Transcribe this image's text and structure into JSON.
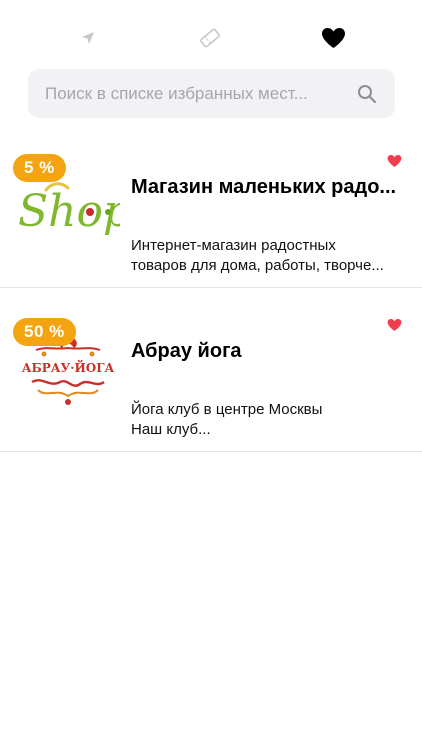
{
  "tabs": [
    {
      "name": "nearby",
      "icon": "location-arrow-icon",
      "active": false
    },
    {
      "name": "coupons",
      "icon": "ticket-icon",
      "active": false
    },
    {
      "name": "favorites",
      "icon": "heart-icon",
      "active": true
    }
  ],
  "search": {
    "placeholder": "Поиск в списке избранных мест...",
    "value": ""
  },
  "items": [
    {
      "badge": "5 %",
      "title": "Магазин маленьких радо...",
      "description_lines": [
        "Интернет-магазин радостных",
        "товаров для дома, работы, творче..."
      ],
      "logo_text": "Shop",
      "favorite": true
    },
    {
      "badge": "50 %",
      "title": "Абрау йога",
      "description_lines": [
        "Йога клуб в центре Москвы",
        "Наш клуб..."
      ],
      "logo_text": "АБРАУ·ЙОГА",
      "favorite": true
    }
  ],
  "colors": {
    "badge": "#f4a411",
    "heart_active": "#f23c4f",
    "inactive_icon": "#c7c7cc",
    "search_bg": "#f2f2f4"
  }
}
